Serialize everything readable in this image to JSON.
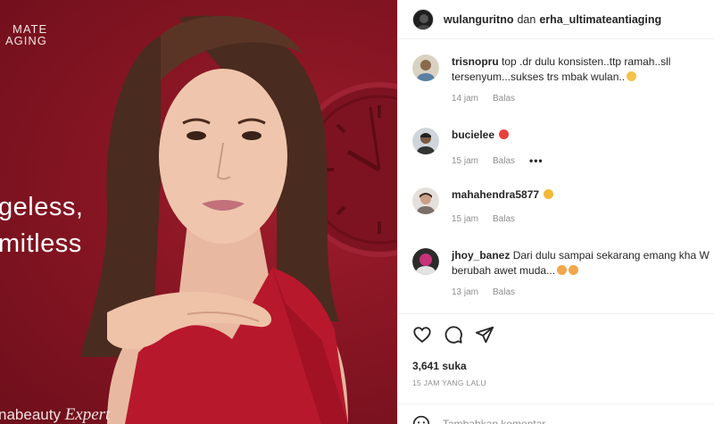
{
  "post_image": {
    "brand_line1": "MATE",
    "brand_line2": "AGING",
    "tagline_line1": "geless,",
    "tagline_line2": "mitless",
    "footer_brand_prefix": "nabeauty",
    "footer_brand_suffix": "Expert"
  },
  "header": {
    "username": "wulanguritno",
    "joiner": "dan",
    "collaborator": "erha_ultimateantiaging"
  },
  "comments": [
    {
      "username": "trisnopru",
      "text_line1": "top .dr dulu konsisten..ttp ramah..sll",
      "text_line2": "tersenyum...sukses trs mbak wulan..",
      "time": "14 jam",
      "reply": "Balas"
    },
    {
      "username": "bucielee",
      "text_line1": "",
      "text_line2": "",
      "time": "15 jam",
      "reply": "Balas",
      "more": "•••"
    },
    {
      "username": "mahahendra5877",
      "text_line1": "",
      "text_line2": "",
      "time": "15 jam",
      "reply": "Balas"
    },
    {
      "username": "jhoy_banez",
      "text_line1": "Dari dulu sampai sekarang emang kha W",
      "text_line2": "berubah awet muda...",
      "time": "13 jam",
      "reply": "Balas"
    }
  ],
  "likes": "3,641 suka",
  "posted_ago": "15 JAM YANG LALU",
  "comment_input": {
    "placeholder": "Tambahkan komentar..."
  },
  "colors": {
    "brand_red": "#8a1624",
    "text": "#262626",
    "muted": "#8e8e8e"
  }
}
